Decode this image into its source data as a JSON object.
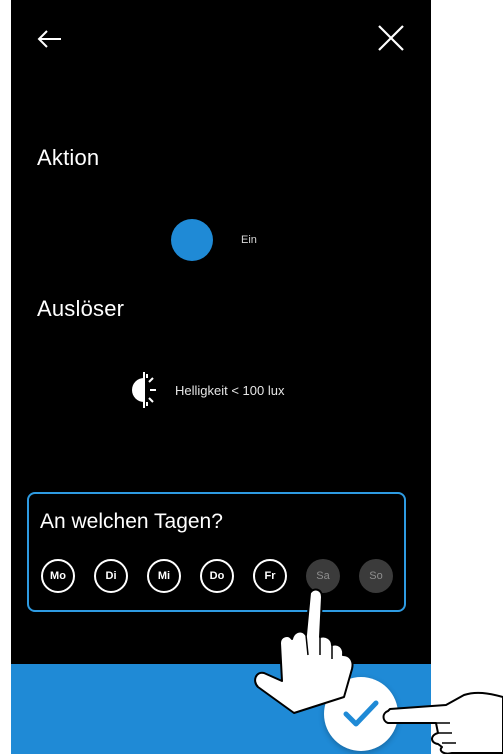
{
  "colors": {
    "accent": "#1f8ad6",
    "screen_background": "#000000",
    "box_border": "#2e9be2",
    "inactive_day": "#3b3b3b"
  },
  "header": {
    "back_icon": "arrow-left-icon",
    "close_icon": "close-icon"
  },
  "action": {
    "title": "Aktion",
    "state_label": "Ein"
  },
  "trigger": {
    "title": "Auslöser",
    "icon": "brightness-icon",
    "label": "Helligkeit < 100 lux"
  },
  "days": {
    "title": "An welchen Tagen?",
    "items": [
      {
        "label": "Mo",
        "selected": true
      },
      {
        "label": "Di",
        "selected": true
      },
      {
        "label": "Mi",
        "selected": true
      },
      {
        "label": "Do",
        "selected": true
      },
      {
        "label": "Fr",
        "selected": true
      },
      {
        "label": "Sa",
        "selected": false
      },
      {
        "label": "So",
        "selected": false
      }
    ]
  },
  "footer": {
    "confirm_icon": "checkmark-icon"
  }
}
